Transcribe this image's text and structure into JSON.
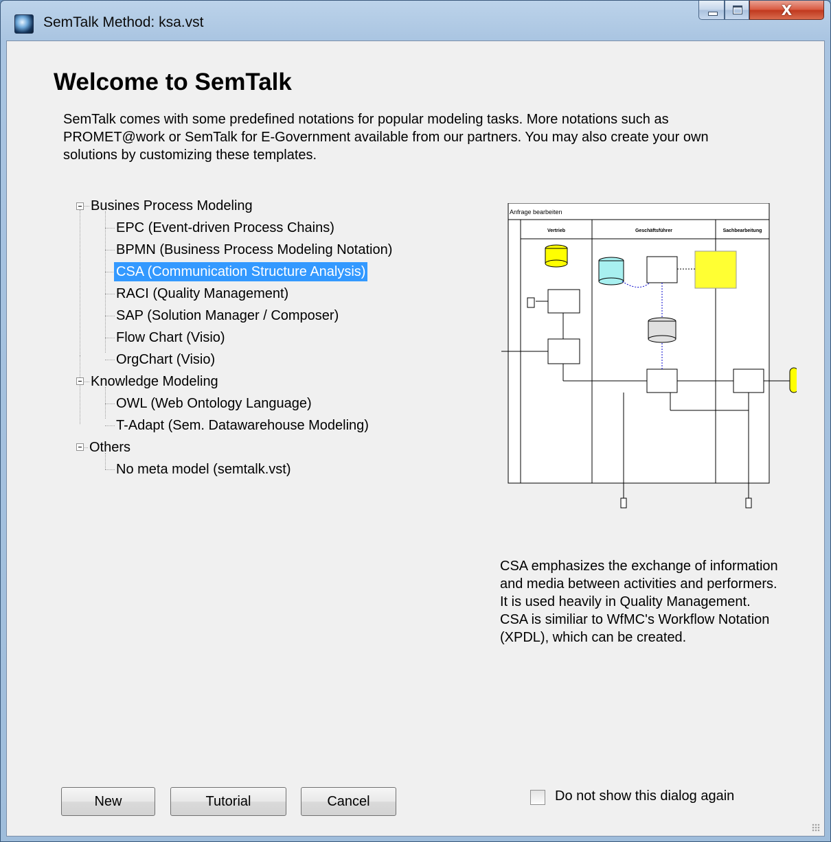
{
  "window": {
    "title": "SemTalk Method: ksa.vst",
    "close_glyph": "X"
  },
  "dialog": {
    "heading": "Welcome to SemTalk",
    "intro": "SemTalk comes with some predefined notations for popular modeling tasks. More notations such as PROMET@work or SemTalk for E-Government available from our partners. You may also create your own solutions by customizing these templates."
  },
  "tree": {
    "groups": [
      {
        "label": "Busines Process Modeling",
        "items": [
          "EPC (Event-driven Process Chains)",
          "BPMN (Business Process Modeling Notation)",
          "CSA (Communication Structure Analysis)",
          "RACI (Quality Management)",
          "SAP (Solution Manager / Composer)",
          "Flow Chart (Visio)",
          "OrgChart (Visio)"
        ]
      },
      {
        "label": "Knowledge Modeling",
        "items": [
          "OWL (Web Ontology Language)",
          "T-Adapt (Sem. Datawarehouse Modeling)"
        ]
      },
      {
        "label": "Others",
        "items": [
          "No meta model (semtalk.vst)"
        ]
      }
    ],
    "selected": "CSA (Communication Structure Analysis)"
  },
  "preview": {
    "title": "Anfrage bearbeiten",
    "lanes": [
      "Vertrieb",
      "Geschäftsführer",
      "Sachbearbeitung"
    ],
    "note_color": "#ffff33",
    "store_color": "#ffff00",
    "store2_color": "#a8f0f0"
  },
  "description": {
    "lines": [
      "CSA emphasizes the exchange of information and media between activities and performers.",
      "It is used heavily in Quality Management.",
      "CSA is similiar to WfMC's Workflow Notation (XPDL), which can be created."
    ]
  },
  "buttons": {
    "new": "New",
    "tutorial": "Tutorial",
    "cancel": "Cancel"
  },
  "checkbox": {
    "label": "Do not show this dialog again",
    "checked": false
  },
  "colors": {
    "selection": "#3399ff",
    "close_button": "#c0381d"
  }
}
